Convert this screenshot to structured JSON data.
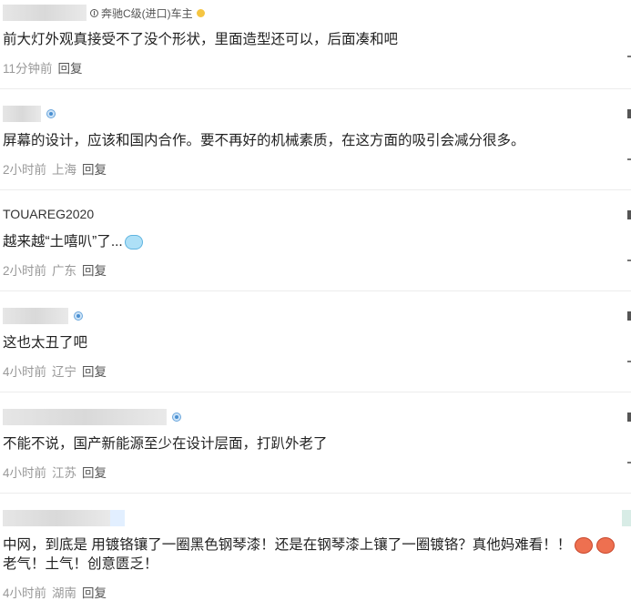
{
  "comments": [
    {
      "username": "",
      "owner_tag": "奔驰C级(进口)车主",
      "car_icon": "car-brand-icon",
      "medal_icon": "medal-icon",
      "text": "前大灯外观真接受不了没个形状，里面造型还可以，后面凑和吧",
      "time": "11分钟前",
      "location": "",
      "reply": "回复"
    },
    {
      "username": "",
      "verified_icon": "verified-badge-icon",
      "text": "屏幕的设计，应该和国内合作。要不再好的机械素质，在这方面的吸引会减分很多。",
      "time": "2小时前",
      "location": "上海",
      "reply": "回复"
    },
    {
      "username": "TOUAREG2020",
      "text": "越来越“土嘻叭”了...",
      "emoji": "sweat-cloud-emoji",
      "time": "2小时前",
      "location": "广东",
      "reply": "回复"
    },
    {
      "username": "",
      "verified_icon": "verified-badge-icon",
      "text": "这也太丑了吧",
      "time": "4小时前",
      "location": "辽宁",
      "reply": "回复"
    },
    {
      "username": "",
      "verified_icon": "verified-badge-icon",
      "text": "不能不说，国产新能源至少在设计层面，打趴外老了",
      "time": "4小时前",
      "location": "江苏",
      "reply": "回复"
    },
    {
      "username": "",
      "text": "中网，到底是 用镀铬镶了一圈黑色钢琴漆！还是在钢琴漆上镶了一圈镀铬？真他妈难看！！",
      "text2": "老气！土气！创意匮乏！",
      "emoji": "angry-face-emoji",
      "time": "4小时前",
      "location": "湖南",
      "reply": "回复"
    }
  ],
  "colors": {
    "text": "#222222",
    "meta": "#999999",
    "reply": "#555555",
    "divider": "#ececec"
  }
}
